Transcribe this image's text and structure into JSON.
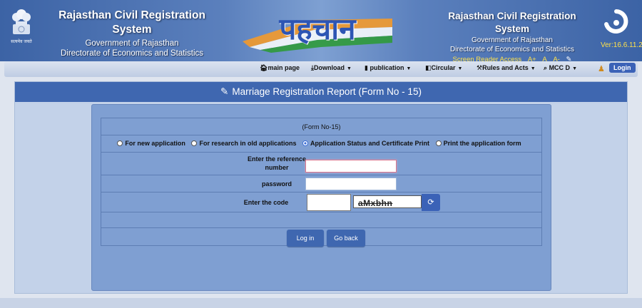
{
  "header": {
    "emblem_caption": "सत्यमेव जयते",
    "left_title": "Rajasthan Civil Registration System",
    "left_sub1": "Government of Rajasthan",
    "left_sub2": "Directorate of Economics and Statistics",
    "brand_text": "पहचान",
    "right_title": "Rajasthan Civil Registration System",
    "right_sub1": "Government of Rajasthan",
    "right_sub2": "Directorate of Economics and Statistics",
    "screen_reader": "Screen Reader Access",
    "font_plus": "A+",
    "font_normal": "A",
    "font_minus": "A-",
    "version": "Ver:16.6.11.24"
  },
  "nav": {
    "main_page": "main page",
    "download": "Download",
    "publication": "publication",
    "circular": "Circular",
    "rules": "Rules and Acts",
    "mcc": "MCC D",
    "login": "Login"
  },
  "panel": {
    "title": "Marriage Registration Report (Form No - 15)"
  },
  "form": {
    "form_no": "(Form No-15)",
    "options": [
      {
        "label": "For new application",
        "selected": false
      },
      {
        "label": "For research in old applications",
        "selected": false
      },
      {
        "label": "Application Status and Certificate Print",
        "selected": true
      },
      {
        "label": "Print the application form",
        "selected": false
      }
    ],
    "ref_label": "Enter the reference number",
    "password_label": "password",
    "code_label": "Enter the code",
    "captcha_value": "aMxbhn",
    "login_button": "Log in",
    "back_button": "Go back"
  },
  "colors": {
    "header_blue": "#3c63a5",
    "panel_head": "#3f67b0",
    "accent_yellow": "#ffe14a"
  }
}
